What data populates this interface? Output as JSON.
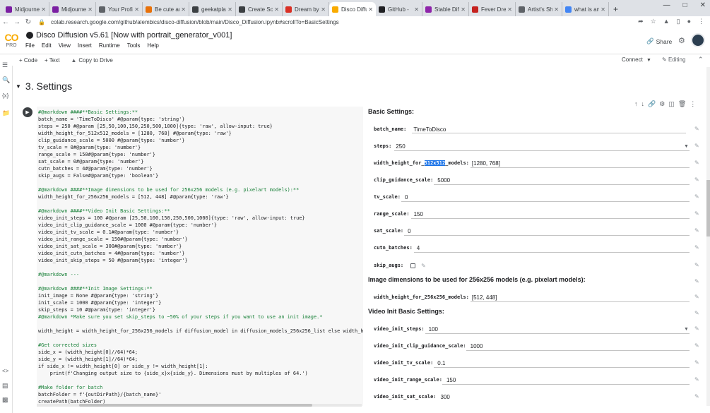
{
  "browser": {
    "tabs": [
      {
        "label": "Midjourney",
        "color": "#7b1fa2"
      },
      {
        "label": "Midjourney",
        "color": "#7b1fa2"
      },
      {
        "label": "Your Profile",
        "color": "#5f6368"
      },
      {
        "label": "Be cute ano",
        "color": "#e8710a"
      },
      {
        "label": "geekatplay",
        "color": "#3c4043"
      },
      {
        "label": "Create Son",
        "color": "#3c4043"
      },
      {
        "label": "Dream by ",
        "color": "#d93025"
      },
      {
        "label": "Disco Diffu",
        "color": "#f9ab00"
      },
      {
        "label": "GitHub - ",
        "color": "#202124"
      },
      {
        "label": "Stable Diffu",
        "color": "#8e24aa"
      },
      {
        "label": "Fever Drea",
        "color": "#c5221f"
      },
      {
        "label": "Artist's Sh",
        "color": "#5f6368"
      },
      {
        "label": "what is an",
        "color": "#4285f4"
      }
    ],
    "active_tab_index": 7,
    "url": "colab.research.google.com/github/alembics/disco-diffusion/blob/main/Disco_Diffusion.ipynb#scrollTo=BasicSettings"
  },
  "colab": {
    "logo": "CO",
    "plan": "PRO",
    "title": "Disco Diffusion v5.61 [Now with portrait_generator_v001]",
    "menus": [
      "File",
      "Edit",
      "View",
      "Insert",
      "Runtime",
      "Tools",
      "Help"
    ],
    "share_label": "Share",
    "toolbar": {
      "code": "+ Code",
      "text": "+ Text",
      "copy": "Copy to Drive",
      "connect": "Connect",
      "editing": "Editing"
    }
  },
  "section": {
    "title": "3. Settings"
  },
  "code_lines": [
    {
      "text": "#@markdown ####**Basic Settings:**",
      "comment": true
    },
    {
      "text": "batch_name = 'TimeToDisco' #@param{type: 'string'}",
      "comment": false
    },
    {
      "text": "steps = 250 #@param [25,50,100,150,250,500,1000]{type: 'raw', allow-input: true}",
      "comment": false
    },
    {
      "text": "width_height_for_512x512_models = [1280, 768] #@param{type: 'raw'}",
      "comment": false
    },
    {
      "text": "clip_guidance_scale = 5000 #@param{type: 'number'}",
      "comment": false
    },
    {
      "text": "tv_scale = 0#@param{type: 'number'}",
      "comment": false
    },
    {
      "text": "range_scale = 150#@param{type: 'number'}",
      "comment": false
    },
    {
      "text": "sat_scale = 0#@param{type: 'number'}",
      "comment": false
    },
    {
      "text": "cutn_batches = 4#@param{type: 'number'}",
      "comment": false
    },
    {
      "text": "skip_augs = False#@param{type: 'boolean'}",
      "comment": false
    },
    {
      "text": "",
      "comment": false
    },
    {
      "text": "#@markdown ####**Image dimensions to be used for 256x256 models (e.g. pixelart models):**",
      "comment": true
    },
    {
      "text": "width_height_for_256x256_models = [512, 448] #@param{type: 'raw'}",
      "comment": false
    },
    {
      "text": "",
      "comment": false
    },
    {
      "text": "#@markdown ####**Video Init Basic Settings:**",
      "comment": true
    },
    {
      "text": "video_init_steps = 100 #@param [25,50,100,150,250,500,1000]{type: 'raw', allow-input: true}",
      "comment": false
    },
    {
      "text": "video_init_clip_guidance_scale = 1000 #@param{type: 'number'}",
      "comment": false
    },
    {
      "text": "video_init_tv_scale = 0.1#@param{type: 'number'}",
      "comment": false
    },
    {
      "text": "video_init_range_scale = 150#@param{type: 'number'}",
      "comment": false
    },
    {
      "text": "video_init_sat_scale = 300#@param{type: 'number'}",
      "comment": false
    },
    {
      "text": "video_init_cutn_batches = 4#@param{type: 'number'}",
      "comment": false
    },
    {
      "text": "video_init_skip_steps = 50 #@param{type: 'integer'}",
      "comment": false
    },
    {
      "text": "",
      "comment": false
    },
    {
      "text": "#@markdown ---",
      "comment": true
    },
    {
      "text": "",
      "comment": false
    },
    {
      "text": "#@markdown ####**Init Image Settings:**",
      "comment": true
    },
    {
      "text": "init_image = None #@param{type: 'string'}",
      "comment": false
    },
    {
      "text": "init_scale = 1000 #@param{type: 'integer'}",
      "comment": false
    },
    {
      "text": "skip_steps = 10 #@param{type: 'integer'}",
      "comment": false
    },
    {
      "text": "#@markdown *Make sure you set skip_steps to ~50% of your steps if you want to use an init image.*",
      "comment": true
    },
    {
      "text": "",
      "comment": false
    },
    {
      "text": "width_height = width_height_for_256x256_models if diffusion_model in diffusion_models_256x256_list else width_hei",
      "comment": false
    },
    {
      "text": "",
      "comment": false
    },
    {
      "text": "#Get corrected sizes",
      "comment": true
    },
    {
      "text": "side_x = (width_height[0]//64)*64;",
      "comment": false
    },
    {
      "text": "side_y = (width_height[1]//64)*64;",
      "comment": false
    },
    {
      "text": "if side_x != width_height[0] or side_y != width_height[1]:",
      "comment": false
    },
    {
      "text": "    print(f'Changing output size to {side_x}x{side_y}. Dimensions must by multiples of 64.')",
      "comment": false
    },
    {
      "text": "",
      "comment": false
    },
    {
      "text": "#Make folder for batch",
      "comment": true
    },
    {
      "text": "batchFolder = f'{outDirPath}/{batch_name}'",
      "comment": false
    },
    {
      "text": "createPath(batchFolder)",
      "comment": false
    }
  ],
  "form": {
    "basic_heading": "Basic Settings:",
    "batch_name": {
      "label": "batch_name:",
      "value": "TimeToDisco"
    },
    "steps": {
      "label": "steps:",
      "value": "250"
    },
    "wh512": {
      "label_pre": "width_height_for_",
      "label_hl": "512x512",
      "label_post": "_models:",
      "value": "[1280, 768]"
    },
    "clip_guidance_scale": {
      "label": "clip_guidance_scale:",
      "value": "5000"
    },
    "tv_scale": {
      "label": "tv_scale:",
      "value": "0"
    },
    "range_scale": {
      "label": "range_scale:",
      "value": "150"
    },
    "sat_scale": {
      "label": "sat_scale:",
      "value": "0"
    },
    "cutn_batches": {
      "label": "cutn_batches:",
      "value": "4"
    },
    "skip_augs": {
      "label": "skip_augs:",
      "checked": false
    },
    "dim_heading": "Image dimensions to be used for 256x256 models (e.g. pixelart models):",
    "wh256": {
      "label": "width_height_for_256x256_models:",
      "value": "[512, 448]"
    },
    "video_heading": "Video Init Basic Settings:",
    "video_init_steps": {
      "label": "video_init_steps:",
      "value": "100"
    },
    "video_init_clip_guidance_scale": {
      "label": "video_init_clip_guidance_scale:",
      "value": "1000"
    },
    "video_init_tv_scale": {
      "label": "video_init_tv_scale:",
      "value": "0.1"
    },
    "video_init_range_scale": {
      "label": "video_init_range_scale:",
      "value": "150"
    },
    "video_init_sat_scale": {
      "label": "video_init_sat_scale:",
      "value": "300"
    }
  }
}
